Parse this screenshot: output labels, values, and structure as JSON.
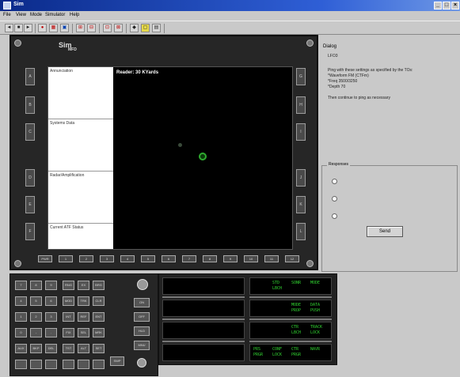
{
  "window": {
    "title": "Sim"
  },
  "menu": {
    "items": [
      "File",
      "View",
      "Mode",
      "Simulator",
      "Help"
    ]
  },
  "toolbar": {
    "buttons": [
      {
        "label": "◄",
        "icon": "rewind-icon"
      },
      {
        "label": "■",
        "icon": "stop-icon"
      },
      {
        "label": "►",
        "icon": "play-icon"
      },
      {
        "label": "●",
        "icon": "record-icon"
      },
      {
        "label": "▦",
        "icon": "grid-icon"
      },
      {
        "label": "▣",
        "icon": "display-icon"
      },
      {
        "label": "⊞",
        "icon": "panel-icon"
      },
      {
        "label": "⊟",
        "icon": "layout-icon"
      },
      {
        "label": "⊡",
        "icon": "view-icon"
      },
      {
        "label": "⊠",
        "icon": "window-icon"
      },
      {
        "label": "◆",
        "icon": "marker-icon"
      },
      {
        "label": "▢",
        "icon": "frame-icon"
      },
      {
        "label": "▤",
        "icon": "list-icon"
      }
    ]
  },
  "mfd": {
    "logo": "Sim",
    "logo_sub": "MFD",
    "window_cells": [
      "Annunciation",
      "Systems Data",
      "Radar/Amplification",
      "Current ATF Status"
    ],
    "radar_heading": "Reader: 30 KYards",
    "bottom_buttons": [
      "PWR",
      "1",
      "2",
      "3",
      "4",
      "5",
      "6",
      "7",
      "8",
      "9",
      "10",
      "11",
      "12"
    ],
    "left_buttons": [
      "A",
      "B",
      "C",
      "D",
      "E",
      "F"
    ],
    "right_buttons": [
      "G",
      "H",
      "I",
      "J",
      "K",
      "L"
    ]
  },
  "dialog": {
    "title": "Dialog",
    "code": "LFO3",
    "body": "Ping with these settings as specified by the TOs:\n*Waveform FM (CTFm)\n*Freq 3500/3250\n*Depth 70\n\nThen continue to ping as necessary",
    "responses_label": "Responses",
    "send_label": "Send"
  },
  "keypad": {
    "keys": [
      "7",
      "8",
      "9",
      "RNG",
      "EX",
      "BRG",
      "4",
      "5",
      "6",
      "MOD",
      "TRK",
      "CLR",
      "1",
      "2",
      "3",
      "INT",
      "REF",
      "ENT",
      "0",
      "-",
      ".",
      "FIX",
      "SEL",
      "MRK",
      "AUX",
      "BKP",
      "DEL",
      "TST",
      "ALT",
      "SET"
    ],
    "side_keys": [
      "ON",
      "OFF",
      "HLD",
      "MNU",
      "SWP"
    ]
  },
  "readouts": {
    "panels": [
      {
        "line1": [
          "",
          "",
          ""
        ],
        "line2": [
          "",
          "",
          ""
        ]
      },
      {
        "line1": [
          "STD",
          "SONR",
          "MODE"
        ],
        "line2": [
          "LBCH",
          "",
          ""
        ]
      },
      {
        "line1": [
          "",
          "",
          ""
        ],
        "line2": [
          "",
          "",
          ""
        ]
      },
      {
        "line1": [
          "MODE",
          "DATA"
        ],
        "line2": [
          "PROP",
          "PUSH"
        ]
      },
      {
        "line1": [
          "",
          "",
          ""
        ],
        "line2": [
          "",
          "",
          ""
        ]
      },
      {
        "line1": [
          "CTR",
          "TRACK"
        ],
        "line2": [
          "LBCH",
          "LOCK"
        ]
      },
      {
        "line1": [
          "",
          "",
          ""
        ],
        "line2": [
          "",
          "",
          ""
        ]
      },
      {
        "line1": [
          "PRS",
          "CONF",
          "CTR",
          "NAVR"
        ],
        "line2": [
          "PRGR",
          "LOCK",
          "PRGR",
          ""
        ]
      }
    ]
  },
  "colors": {
    "lcd_green": "#31d431",
    "target_green": "#2faa2f",
    "title_blue": "#0a2a8a"
  }
}
